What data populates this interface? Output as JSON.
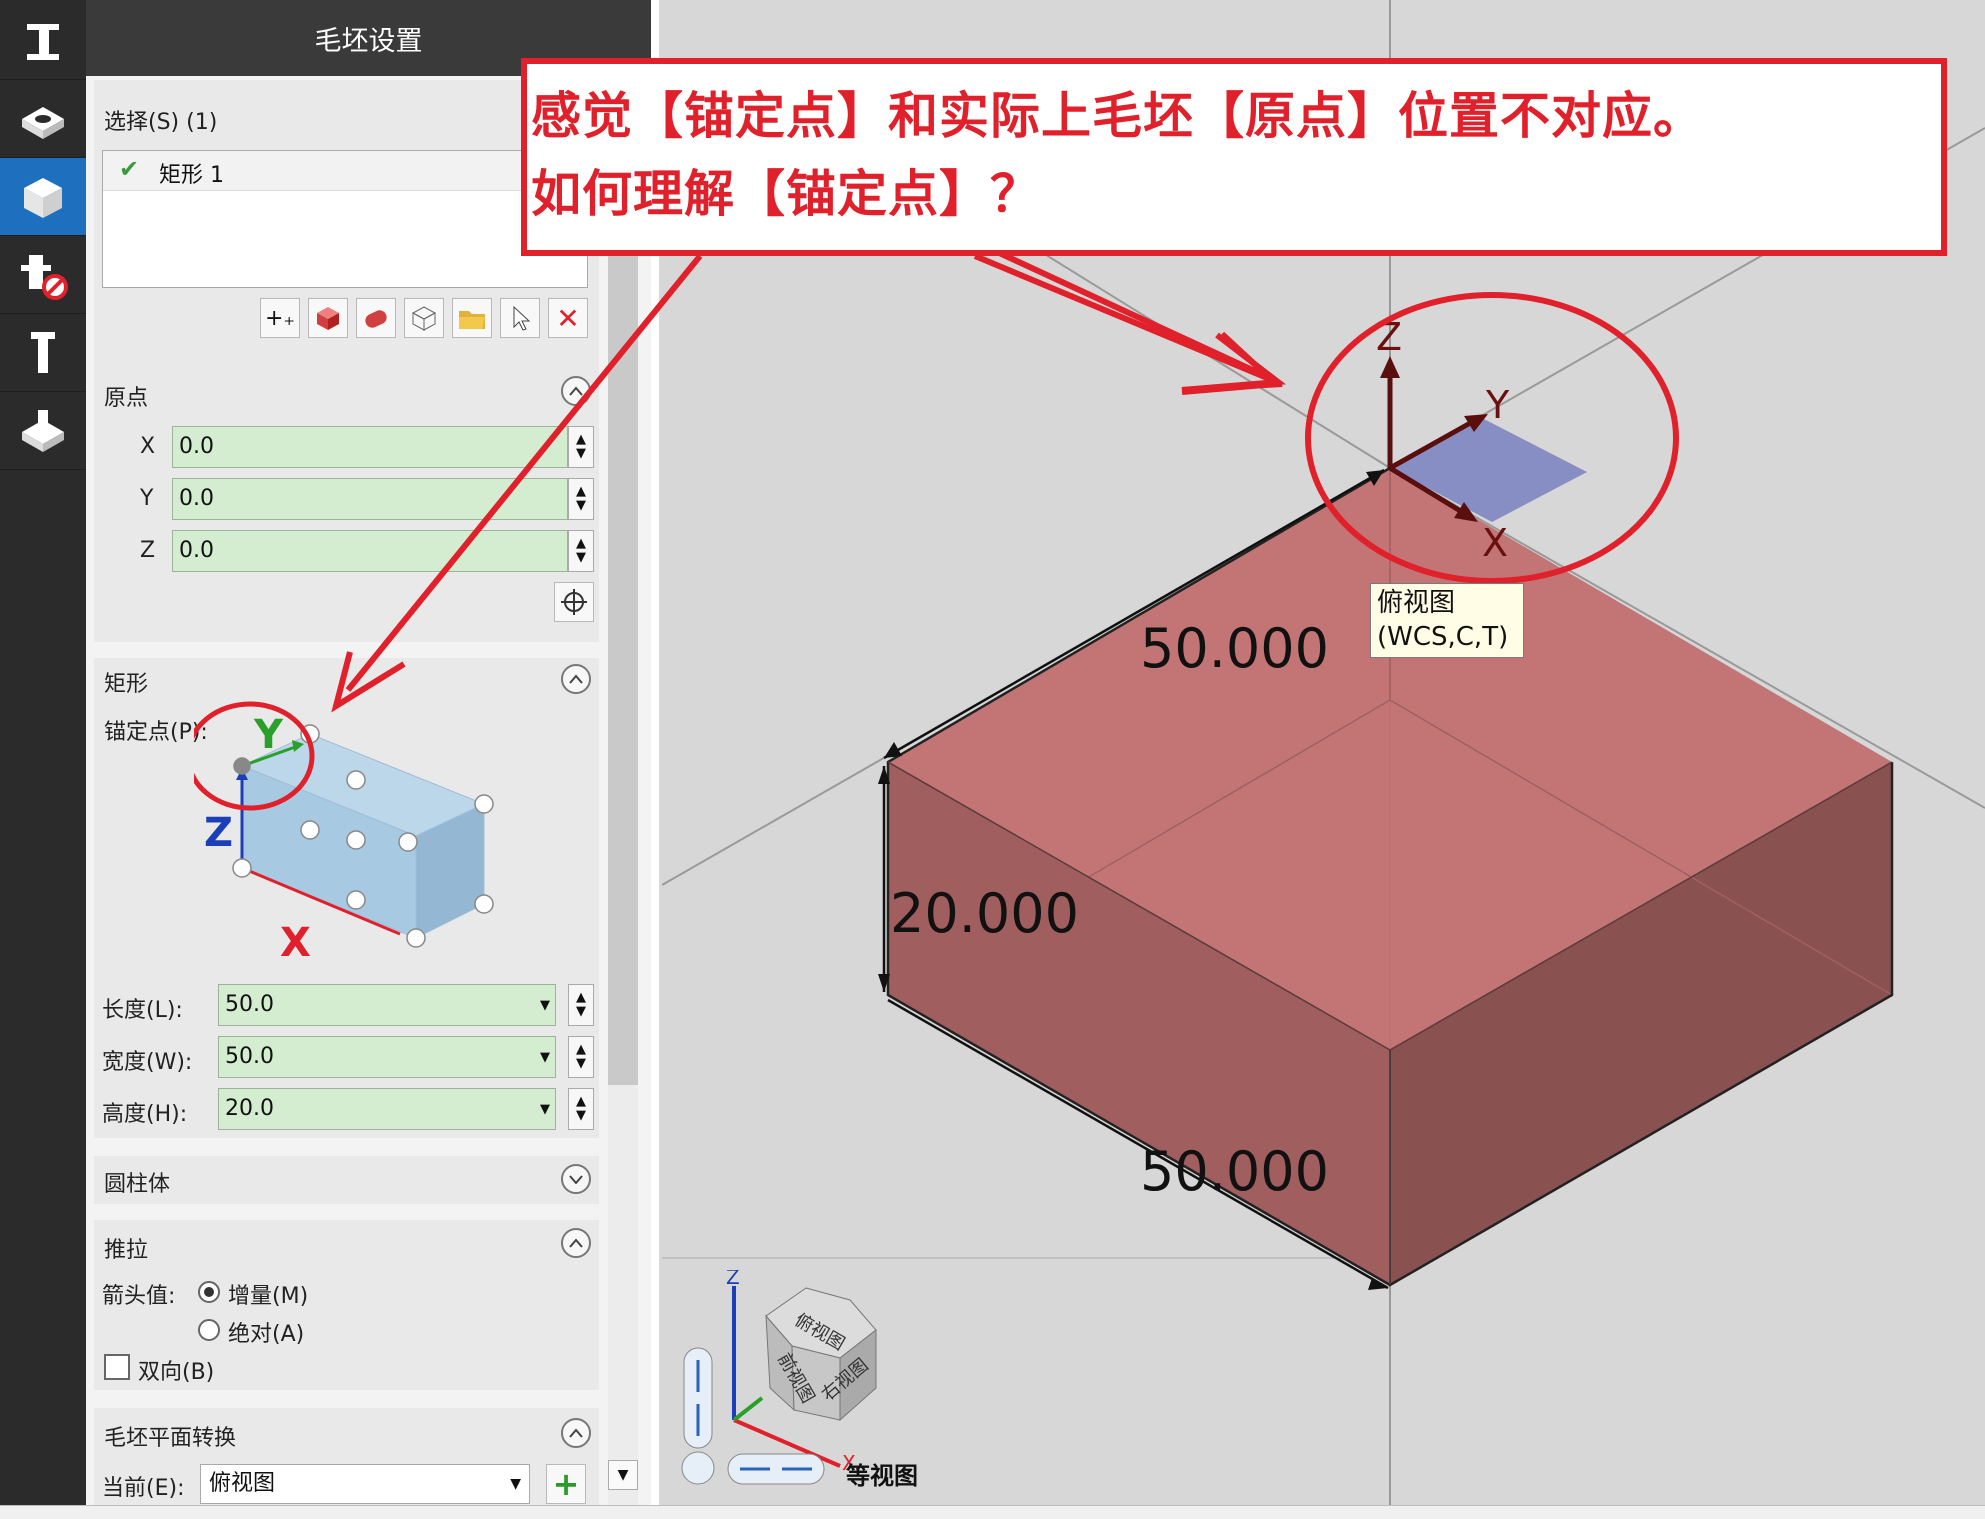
{
  "panel": {
    "title": "毛坯设置",
    "selection": {
      "label": "选择(S) (1)",
      "items": [
        "矩形 1"
      ]
    },
    "origin": {
      "title": "原点",
      "x_label": "X",
      "y_label": "Y",
      "z_label": "Z",
      "x": "0.0",
      "y": "0.0",
      "z": "0.0"
    },
    "rectangle": {
      "title": "矩形",
      "anchor_label": "锚定点(P):",
      "axis_x": "X",
      "axis_y": "Y",
      "axis_z": "Z",
      "length_label": "长度(L):",
      "length": "50.0",
      "width_label": "宽度(W):",
      "width": "50.0",
      "height_label": "高度(H):",
      "height": "20.0"
    },
    "cylinder": {
      "title": "圆柱体"
    },
    "extrude": {
      "title": "推拉",
      "arrow_label": "箭头值:",
      "incremental": "增量(M)",
      "absolute": "绝对(A)",
      "bidirectional": "双向(B)",
      "selected": "incremental"
    },
    "plane_transform": {
      "title": "毛坯平面转换",
      "current_label": "当前(E):",
      "current_value": "俯视图"
    }
  },
  "annotation": {
    "line1": "感觉【锚定点】和实际上毛坯【原点】位置不对应。",
    "line2": "如何理解【锚定点】？",
    "color": "#e0202a"
  },
  "viewport": {
    "dim_top": "50.000",
    "dim_height": "20.000",
    "dim_bottom": "50.000",
    "triad": {
      "x": "X",
      "y": "Y",
      "z": "Z"
    },
    "tooltip_line1": "俯视图",
    "tooltip_line2": "(WCS,C,T)",
    "view_cube": {
      "top": "俯视图",
      "front": "前视图",
      "right": "右视图",
      "label": "等视图",
      "x": "X",
      "z": "Z"
    },
    "block_color": "#c07070"
  }
}
